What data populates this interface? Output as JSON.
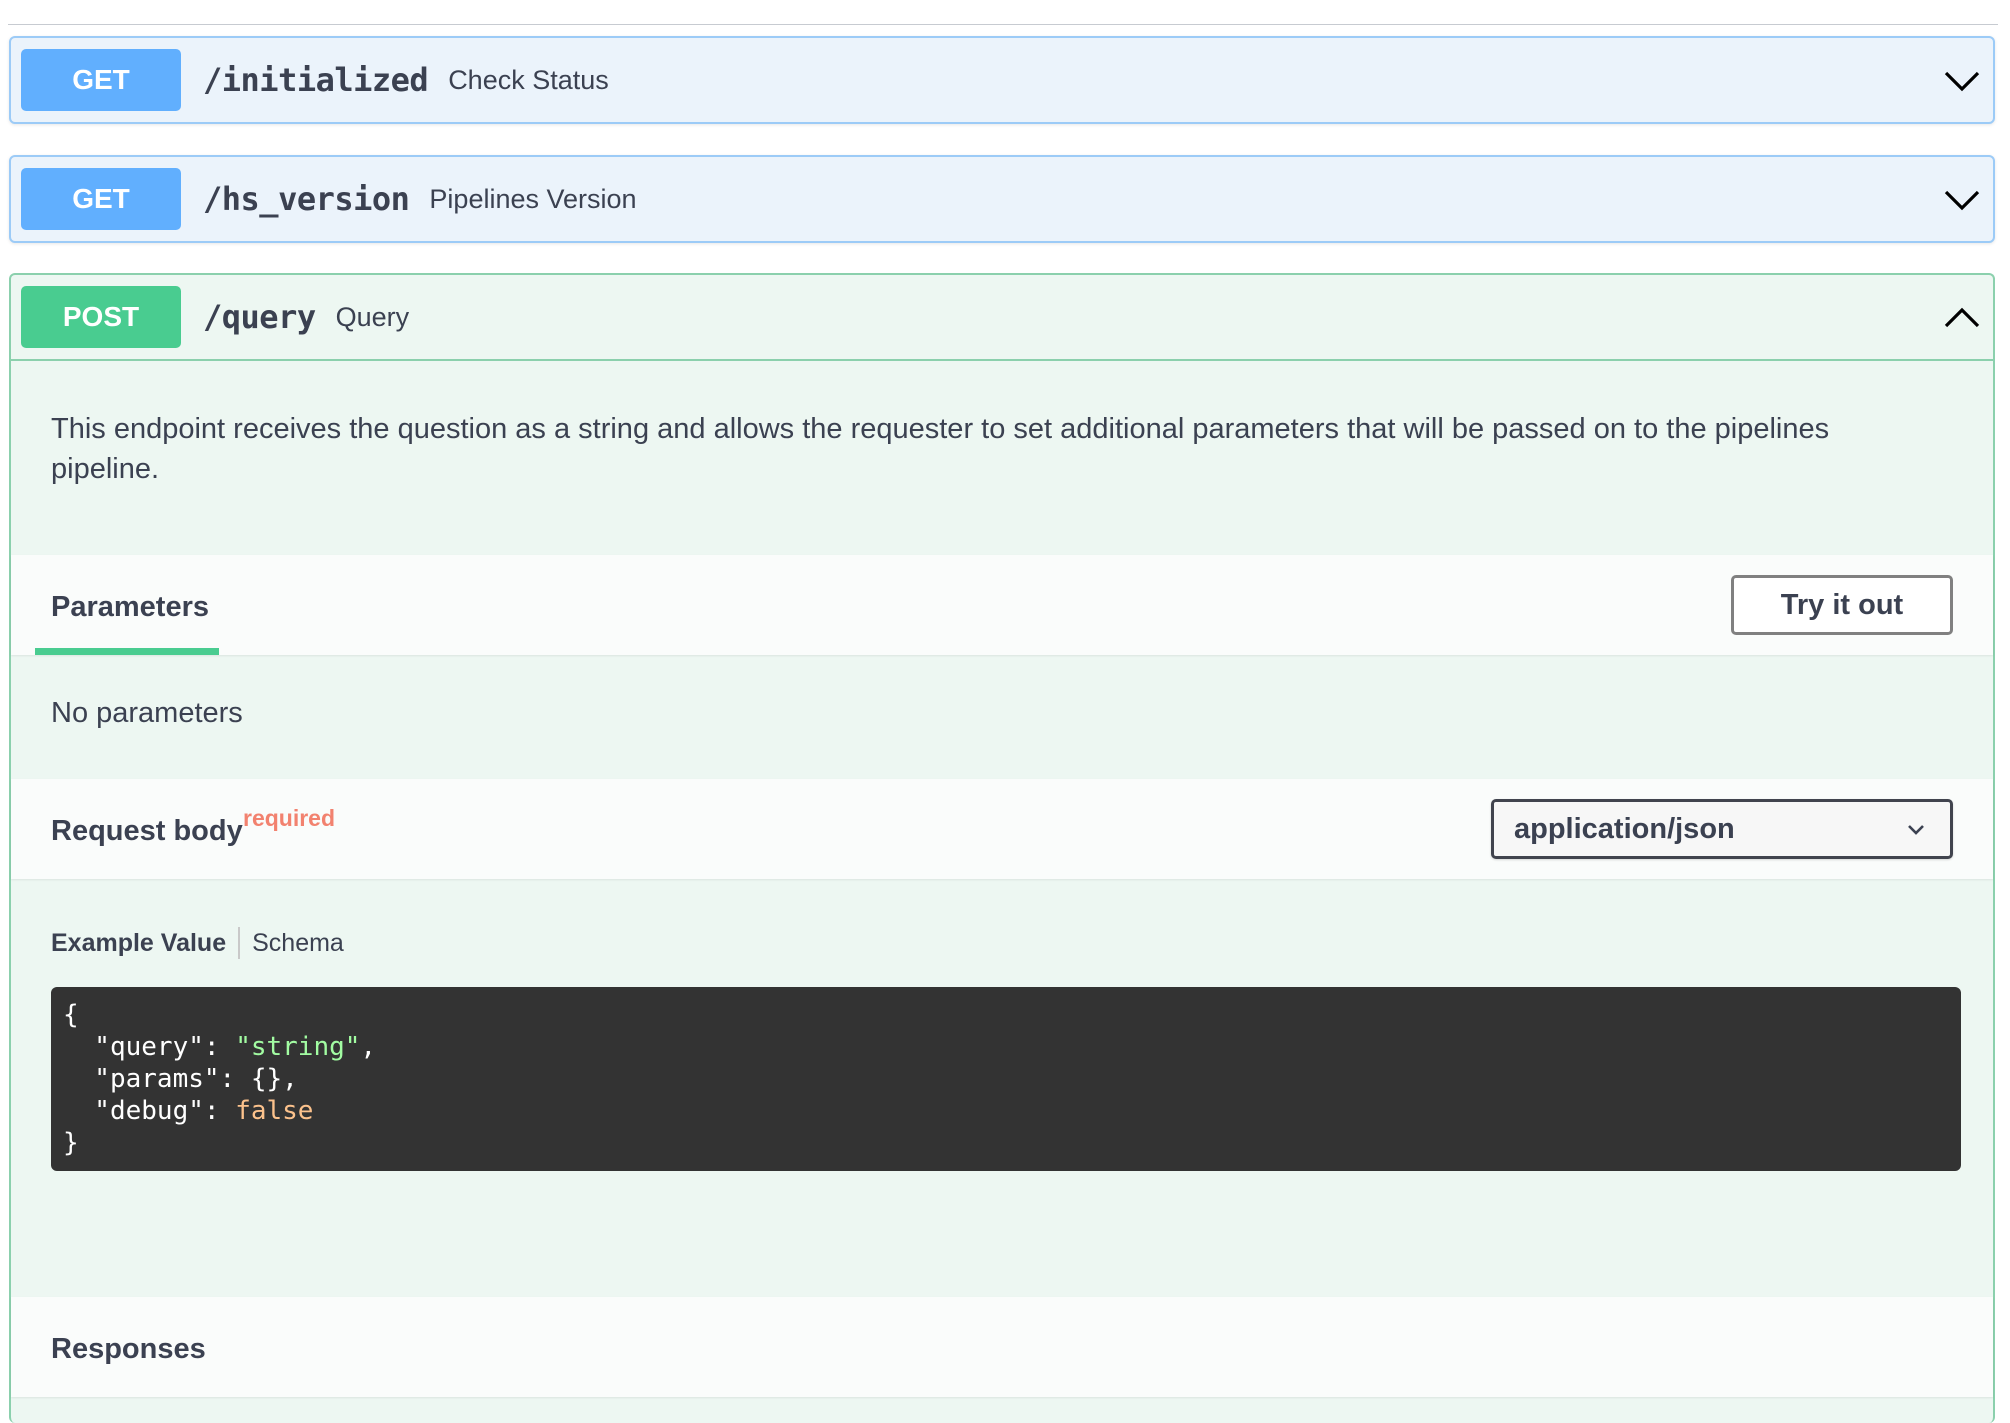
{
  "operations": [
    {
      "method": "GET",
      "path": "/initialized",
      "summary": "Check Status",
      "expanded": false
    },
    {
      "method": "GET",
      "path": "/hs_version",
      "summary": "Pipelines Version",
      "expanded": false
    },
    {
      "method": "POST",
      "path": "/query",
      "summary": "Query",
      "expanded": true
    }
  ],
  "query_op": {
    "description": "This endpoint receives the question as a string and allows the requester to set additional parameters that will be passed on to the pipelines pipeline.",
    "parameters_tab": "Parameters",
    "try_it_out_label": "Try it out",
    "no_parameters_text": "No parameters",
    "request_body_label": "Request body",
    "required_label": "required",
    "content_type": "application/json",
    "example_tab": "Example Value",
    "schema_tab": "Schema",
    "example_code": {
      "open": "{",
      "line1_key": "  \"query\": ",
      "line1_val": "\"string\"",
      "line1_end": ",",
      "line2": "  \"params\": {},",
      "line3_key": "  \"debug\": ",
      "line3_val": "false",
      "close": "}"
    },
    "responses_label": "Responses"
  },
  "colors": {
    "get": "#61affe",
    "post": "#49cc90",
    "required": "#f2826f",
    "code_bg": "#333333"
  },
  "icons": {
    "collapsed": "chevron-down-icon",
    "expanded": "chevron-up-icon",
    "select": "chevron-down-icon"
  }
}
